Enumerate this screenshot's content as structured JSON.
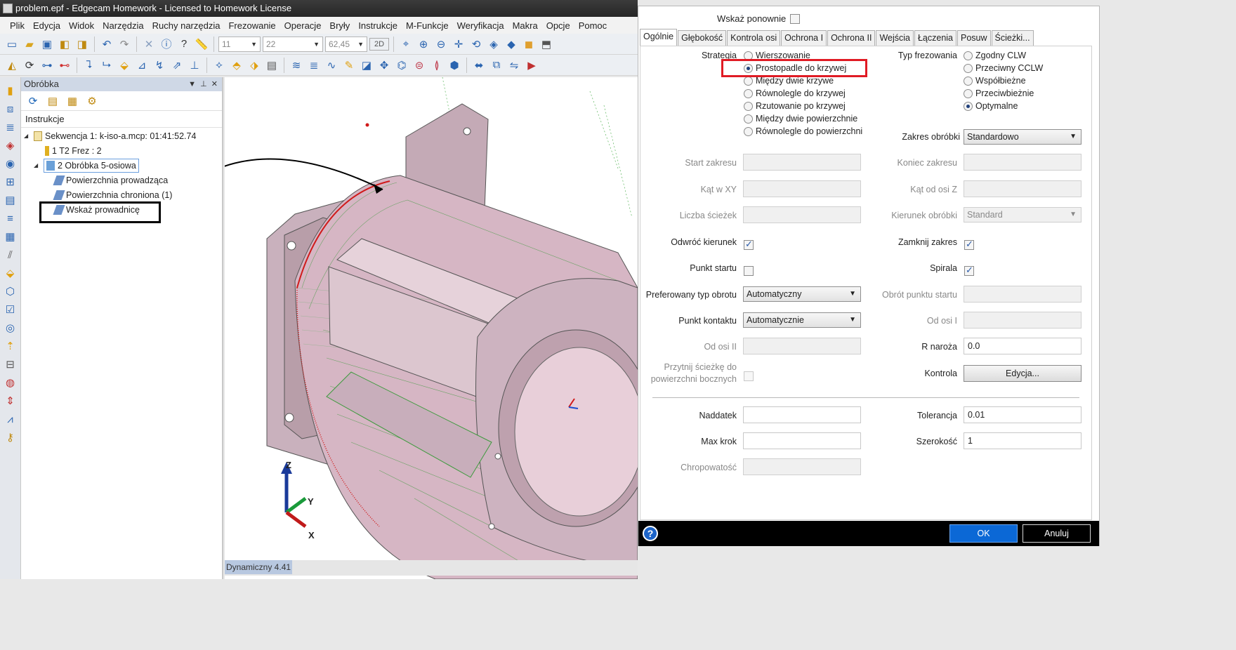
{
  "window": {
    "title": "problem.epf - Edgecam Homework - Licensed to Homework License"
  },
  "menu": [
    "Plik",
    "Edycja",
    "Widok",
    "Narzędzia",
    "Ruchy narzędzia",
    "Frezowanie",
    "Operacje",
    "Bryły",
    "Instrukcje",
    "M-Funkcje",
    "Weryfikacja",
    "Makra",
    "Opcje",
    "Pomoc"
  ],
  "toolbar": {
    "combo1": "11",
    "combo2": "22",
    "combo3": "62,45",
    "mode": "2D"
  },
  "panel": {
    "title": "Obróbka",
    "tree_header": "Instrukcje",
    "nodes": {
      "seq": "Sekwencja 1: k-iso-a.mcp: 01:41:52.74",
      "tool": "1 T2 Frez : 2",
      "op": "2 Obróbka 5-osiowa",
      "drive": "Powierzchnia prowadząca",
      "protect": "Powierzchnia chroniona (1)",
      "guide": "Wskaż prowadnicę"
    }
  },
  "viewport": {
    "axis_z": "Z",
    "axis_y": "Y",
    "axis_x": "X",
    "status": "Dynamiczny 4.41"
  },
  "dialog": {
    "show_again": "Wskaż ponownie",
    "tabs": [
      "Ogólnie",
      "Głębokość",
      "Kontrola osi",
      "Ochrona I",
      "Ochrona II",
      "Wejścia",
      "Łączenia",
      "Posuw",
      "Ścieżki..."
    ],
    "strategy": {
      "label": "Strategia",
      "options": [
        "Wierszowanie",
        "Prostopadle do krzywej",
        "Między dwie krzywe",
        "Równolegle do krzywej",
        "Rzutowanie po krzywej",
        "Między dwie powierzchnie",
        "Równolegle do powierzchni"
      ],
      "selected": "Prostopadle do krzywej"
    },
    "milling_type": {
      "label": "Typ frezowania",
      "options": [
        "Zgodny CLW",
        "Przeciwny CCLW",
        "Współbieżne",
        "Przeciwbieżnie",
        "Optymalne"
      ],
      "selected": "Optymalne"
    },
    "range": {
      "label": "Zakres obróbki",
      "value": "Standardowo"
    },
    "fields": {
      "start": "Start zakresu",
      "end": "Koniec zakresu",
      "angle_xy": "Kąt w XY",
      "angle_z": "Kąt od osi Z",
      "num_paths": "Liczba ścieżek",
      "direction": "Kierunek obróbki",
      "direction_value": "Standard",
      "reverse": "Odwróć kierunek",
      "close": "Zamknij zakres",
      "start_point": "Punkt startu",
      "spiral": "Spirala",
      "pref_rot": "Preferowany typ obrotu",
      "pref_rot_value": "Automatyczny",
      "rot_start": "Obrót punktu startu",
      "contact": "Punkt kontaktu",
      "contact_value": "Automatycznie",
      "from_axis_1": "Od osi I",
      "from_axis_2": "Od osi II",
      "corner_r": "R naroża",
      "corner_r_value": "0.0",
      "trim_line1": "Przytnij ścieżkę do",
      "trim_line2": "powierzchni bocznych",
      "control": "Kontrola",
      "edit": "Edycja...",
      "allowance": "Naddatek",
      "tolerance": "Tolerancja",
      "tolerance_value": "0.01",
      "max_step": "Max krok",
      "width": "Szerokość",
      "width_value": "1",
      "roughness": "Chropowatość"
    },
    "ok": "OK",
    "cancel": "Anuluj"
  }
}
